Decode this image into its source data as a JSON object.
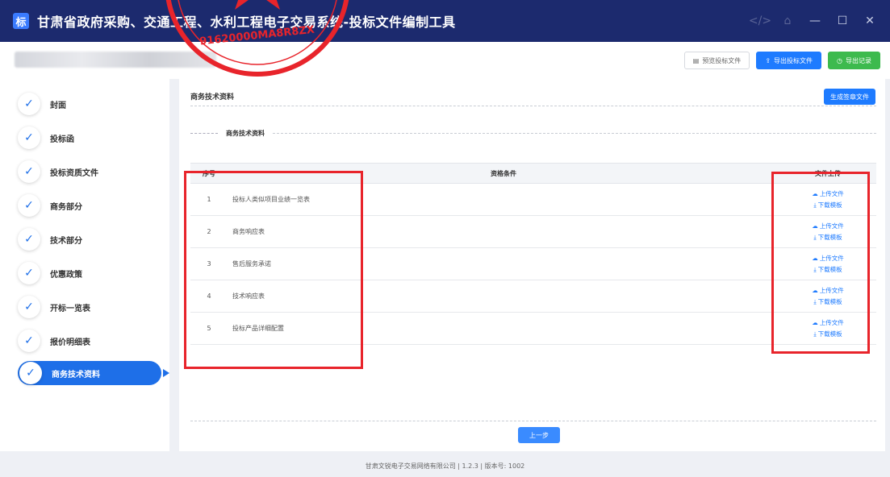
{
  "window": {
    "title": "甘肃省政府采购、交通工程、水利工程电子交易系统-投标文件编制工具",
    "logo_text": "标",
    "controls": [
      "</>",
      "⌂",
      "—",
      "☐",
      "✕"
    ]
  },
  "toolbar": {
    "preview_label": "预览投标文件",
    "export_label": "导出投标文件",
    "record_label": "导出记录"
  },
  "sidebar": {
    "items": [
      {
        "label": "封面"
      },
      {
        "label": "投标函"
      },
      {
        "label": "投标资质文件"
      },
      {
        "label": "商务部分"
      },
      {
        "label": "技术部分"
      },
      {
        "label": "优惠政策"
      },
      {
        "label": "开标一览表"
      },
      {
        "label": "报价明细表"
      },
      {
        "label": "商务技术资料"
      }
    ]
  },
  "main": {
    "section_title": "商务技术资料",
    "generate_label": "生成签章文件",
    "sub_heading": "商务技术资料",
    "table": {
      "headers": [
        "序号",
        "资格条件",
        "文件上传"
      ],
      "rows": [
        {
          "no": "1",
          "name": "投标人类似项目业绩一览表"
        },
        {
          "no": "2",
          "name": "商务响应表"
        },
        {
          "no": "3",
          "name": "售后服务承诺"
        },
        {
          "no": "4",
          "name": "技术响应表"
        },
        {
          "no": "5",
          "name": "投标产品详细配置"
        }
      ],
      "upload_label": "上传文件",
      "download_label": "下载模板"
    },
    "prev_label": "上一步"
  },
  "footer": {
    "text": "甘肃文锐电子交易网络有限公司 | 1.2.3 | 版本号: 1002"
  },
  "stamp": {
    "code": "91620000MA8R8ZX"
  },
  "colors": {
    "titlebar": "#1c2a6e",
    "accent": "#1e7bff",
    "green": "#3dba4e",
    "highlight": "#e8242b"
  }
}
